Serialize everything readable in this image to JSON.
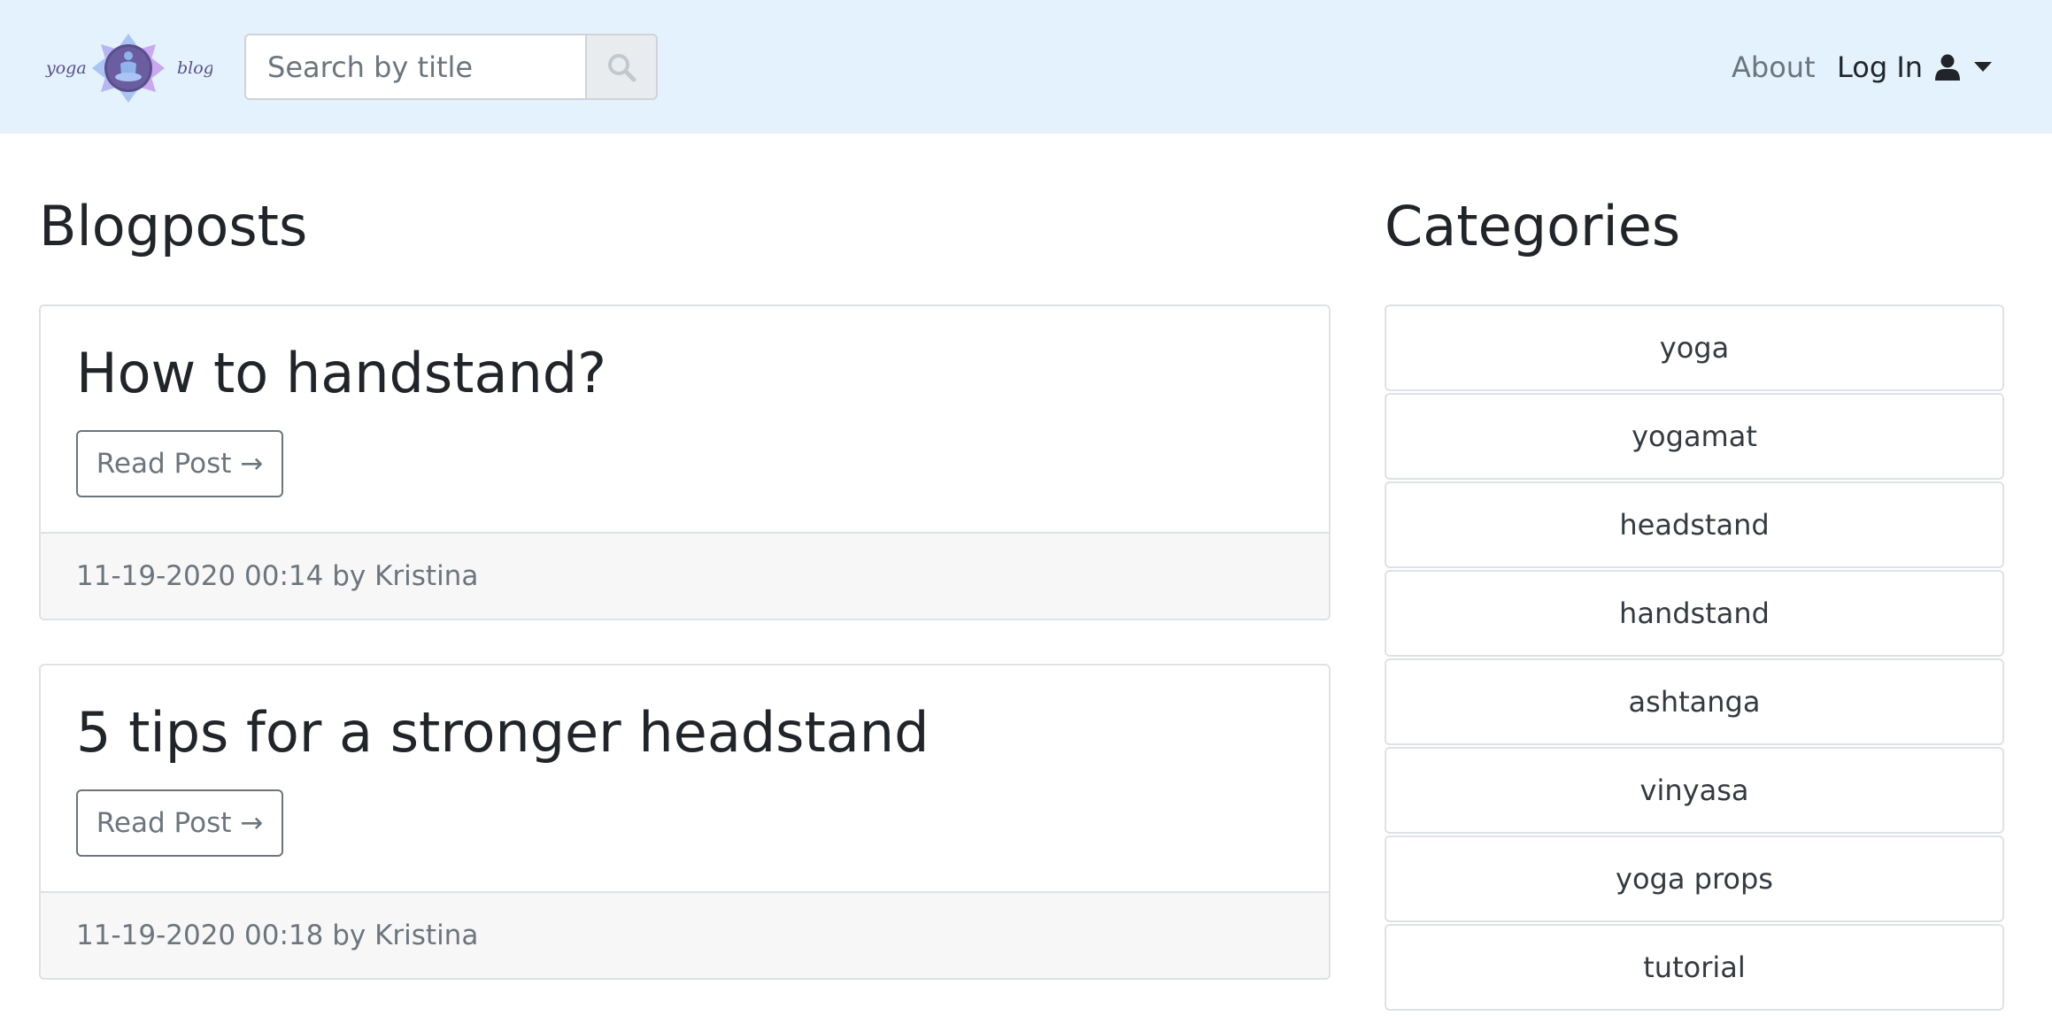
{
  "header": {
    "logo": {
      "text_left": "yoga",
      "text_right": "blog",
      "icon": "meditation-lotus-icon"
    },
    "search": {
      "placeholder": "Search by title",
      "value": "",
      "button_icon": "search-icon"
    },
    "nav": {
      "about_label": "About",
      "login_label": "Log In",
      "login_icon": "user-icon",
      "dropdown_icon": "caret-down-icon"
    }
  },
  "main": {
    "title": "Blogposts",
    "posts": [
      {
        "title": "How to handstand?",
        "button_label": "Read Post →",
        "meta": "11-19-2020 00:14 by Kristina"
      },
      {
        "title": "5 tips for a stronger headstand",
        "button_label": "Read Post →",
        "meta": "11-19-2020 00:18 by Kristina"
      }
    ]
  },
  "sidebar": {
    "title": "Categories",
    "items": [
      {
        "label": "yoga"
      },
      {
        "label": "yogamat"
      },
      {
        "label": "headstand"
      },
      {
        "label": "handstand"
      },
      {
        "label": "ashtanga"
      },
      {
        "label": "vinyasa"
      },
      {
        "label": "yoga props"
      },
      {
        "label": "tutorial"
      }
    ]
  },
  "colors": {
    "navbar_bg": "#e3f2fd",
    "logo_text": "#5a4f8c",
    "muted_text": "#6c757d",
    "border": "#dee2e6",
    "card_footer_bg": "#f7f7f7"
  }
}
